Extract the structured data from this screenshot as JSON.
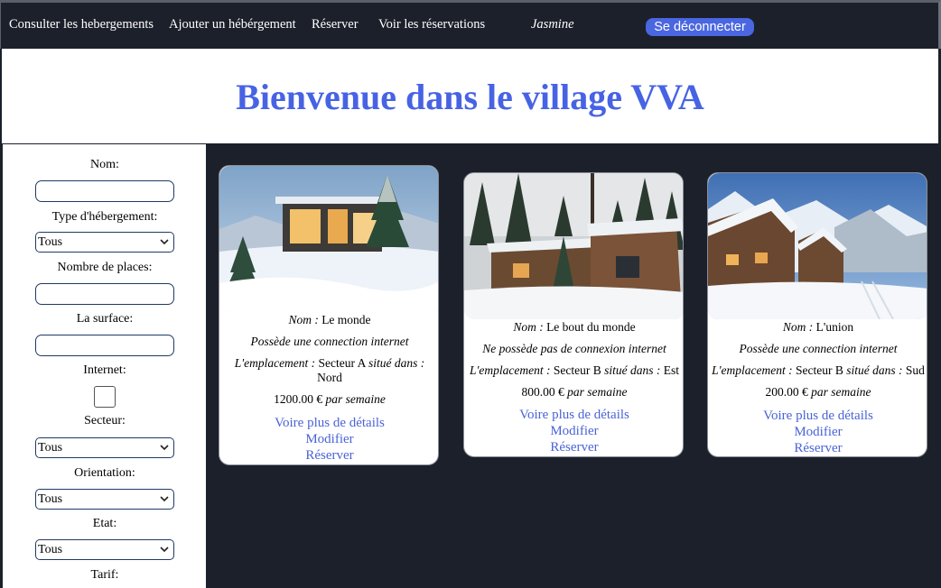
{
  "nav": {
    "consult": "Consulter les hebergements",
    "add": "Ajouter un hébérgement",
    "reserve": "Réserver",
    "reservations": "Voir les réservations",
    "user": "Jasmine",
    "logout": "Se déconnecter"
  },
  "header": {
    "title": "Bienvenue dans le village VVA"
  },
  "filters": {
    "nom_label": "Nom:",
    "type_label": "Type d'hébergement:",
    "type_value": "Tous",
    "places_label": "Nombre de places:",
    "surface_label": "La surface:",
    "internet_label": "Internet:",
    "secteur_label": "Secteur:",
    "secteur_value": "Tous",
    "orientation_label": "Orientation:",
    "orientation_value": "Tous",
    "etat_label": "Etat:",
    "etat_value": "Tous",
    "tarif_label": "Tarif:"
  },
  "cards": [
    {
      "nom_label": "Nom :",
      "nom": "Le monde",
      "internet": "Possède une connection internet",
      "emp_label": "L'emplacement :",
      "secteur": "Secteur A",
      "situe": "situé dans :",
      "orientation": "Nord",
      "price": "1200.00 €",
      "per": "par semaine",
      "details": "Voire plus de détails",
      "modifier": "Modifier",
      "reserver": "Réserver"
    },
    {
      "nom_label": "Nom :",
      "nom": "Le bout du monde",
      "internet": "Ne possède pas de connexion internet",
      "emp_label": "L'emplacement :",
      "secteur": "Secteur B",
      "situe": "situé dans :",
      "orientation": "Est",
      "price": "800.00 €",
      "per": "par semaine",
      "details": "Voire plus de détails",
      "modifier": "Modifier",
      "reserver": "Réserver"
    },
    {
      "nom_label": "Nom :",
      "nom": "L'union",
      "internet": "Possède une connection internet",
      "emp_label": "L'emplacement :",
      "secteur": "Secteur B",
      "situe": "situé dans :",
      "orientation": "Sud",
      "price": "200.00 €",
      "per": "par semaine",
      "details": "Voire plus de détails",
      "modifier": "Modifier",
      "reserver": "Réserver"
    }
  ],
  "colors": {
    "nav_bg": "#1b202b",
    "accent": "#4763e4",
    "link": "#4a63d6",
    "button": "#4a66e0"
  }
}
